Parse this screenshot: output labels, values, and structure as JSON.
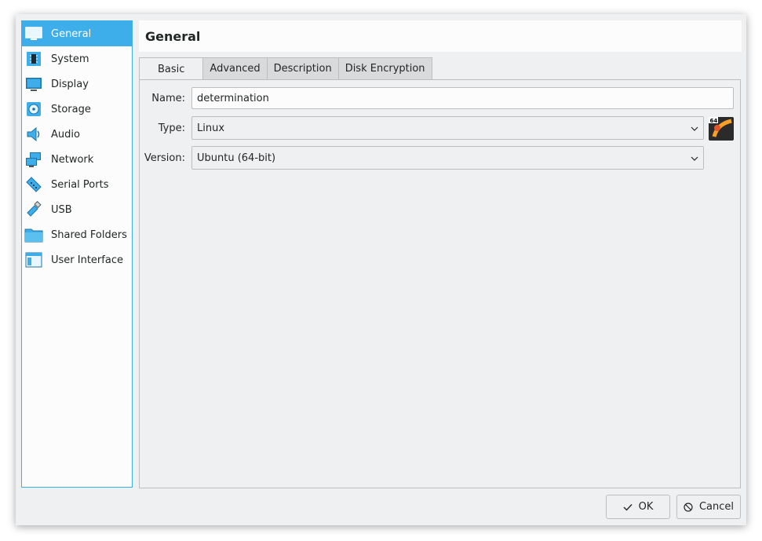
{
  "sidebar": {
    "items": [
      {
        "label": "General",
        "icon": "general-icon",
        "active": true
      },
      {
        "label": "System",
        "icon": "chip-icon",
        "active": false
      },
      {
        "label": "Display",
        "icon": "monitor-icon",
        "active": false
      },
      {
        "label": "Storage",
        "icon": "disk-icon",
        "active": false
      },
      {
        "label": "Audio",
        "icon": "speaker-icon",
        "active": false
      },
      {
        "label": "Network",
        "icon": "network-icon",
        "active": false
      },
      {
        "label": "Serial Ports",
        "icon": "serial-port-icon",
        "active": false
      },
      {
        "label": "USB",
        "icon": "usb-icon",
        "active": false
      },
      {
        "label": "Shared Folders",
        "icon": "folder-icon",
        "active": false
      },
      {
        "label": "User Interface",
        "icon": "window-icon",
        "active": false
      }
    ]
  },
  "header": {
    "title": "General"
  },
  "tabs": [
    {
      "label": "Basic",
      "active": true
    },
    {
      "label": "Advanced",
      "active": false
    },
    {
      "label": "Description",
      "active": false
    },
    {
      "label": "Disk Encryption",
      "active": false
    }
  ],
  "basic": {
    "name_label": "Name:",
    "name_value": "determination",
    "type_label": "Type:",
    "type_value": "Linux",
    "version_label": "Version:",
    "version_value": "Ubuntu (64-bit)",
    "os_badge_text": "64"
  },
  "buttons": {
    "ok_label": "OK",
    "cancel_label": "Cancel"
  },
  "colors": {
    "accent": "#3daee9",
    "window_bg": "#eff0f1",
    "field_bg": "#fcfcfc",
    "border": "#bdbebf"
  }
}
